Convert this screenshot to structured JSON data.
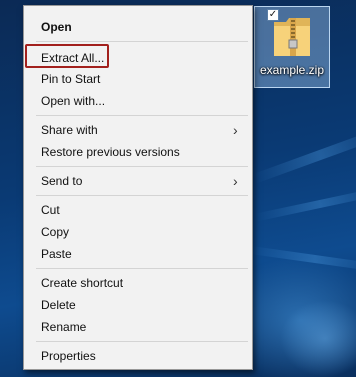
{
  "desktop": {
    "file_icon": {
      "name": "example.zip",
      "icon": "zip-folder-icon",
      "checked": true,
      "selection_color": "#99bde6"
    }
  },
  "context_menu": {
    "items": [
      {
        "label": "Open",
        "bold": true
      },
      {
        "label": "Extract All...",
        "highlighted": true
      },
      {
        "label": "Pin to Start"
      },
      {
        "label": "Open with..."
      },
      {
        "label": "Share with",
        "submenu": true
      },
      {
        "label": "Restore previous versions"
      },
      {
        "label": "Send to",
        "submenu": true
      },
      {
        "label": "Cut"
      },
      {
        "label": "Copy"
      },
      {
        "label": "Paste"
      },
      {
        "label": "Create shortcut"
      },
      {
        "label": "Delete"
      },
      {
        "label": "Rename"
      },
      {
        "label": "Properties"
      }
    ],
    "submenu_icon": "chevron-right-icon",
    "highlight_color": "#a2201d",
    "background_color": "#f2f2f2"
  }
}
